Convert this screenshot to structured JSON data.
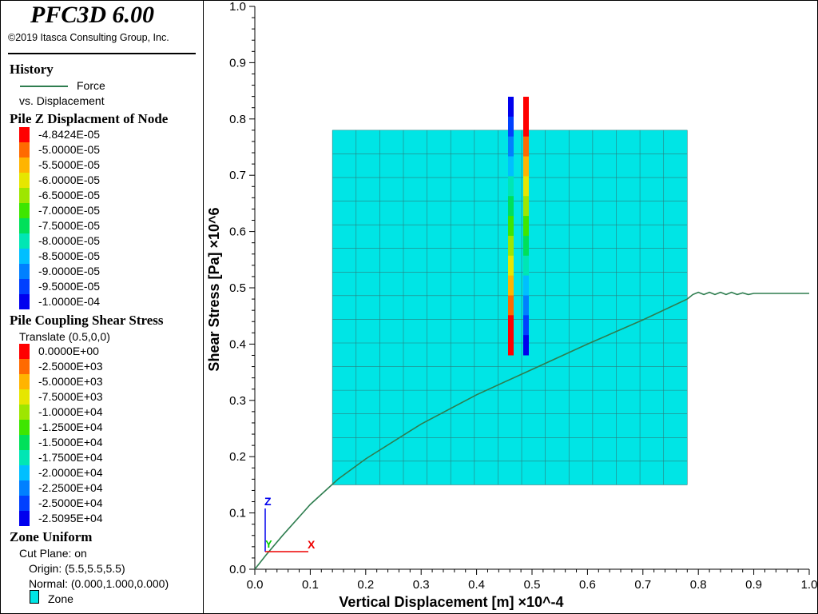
{
  "header": {
    "app_title": "PFC3D 6.00",
    "copyright": "©2019 Itasca Consulting Group, Inc."
  },
  "legend": {
    "history": {
      "heading": "History",
      "series_label": "Force",
      "sub_label": "vs. Displacement",
      "line_color": "#2e7d4f"
    },
    "pile_z": {
      "heading": "Pile Z Displacment of Node",
      "labels": [
        "-4.8424E-05",
        "-5.0000E-05",
        "-5.5000E-05",
        "-6.0000E-05",
        "-6.5000E-05",
        "-7.0000E-05",
        "-7.5000E-05",
        "-8.0000E-05",
        "-8.5000E-05",
        "-9.0000E-05",
        "-9.5000E-05",
        "-1.0000E-04"
      ],
      "colors": [
        "#ff0000",
        "#ff6a00",
        "#ffb400",
        "#e6e600",
        "#9ee600",
        "#3ee600",
        "#00e05a",
        "#00e6b4",
        "#00bfff",
        "#0080ff",
        "#0040ff",
        "#0000ee"
      ]
    },
    "pile_shear": {
      "heading": "Pile Coupling Shear Stress",
      "subtitle": "Translate (0.5,0,0)",
      "labels": [
        "0.0000E+00",
        "-2.5000E+03",
        "-5.0000E+03",
        "-7.5000E+03",
        "-1.0000E+04",
        "-1.2500E+04",
        "-1.5000E+04",
        "-1.7500E+04",
        "-2.0000E+04",
        "-2.2500E+04",
        "-2.5000E+04",
        "-2.5095E+04"
      ],
      "colors": [
        "#ff0000",
        "#ff6a00",
        "#ffb400",
        "#e6e600",
        "#9ee600",
        "#3ee600",
        "#00e05a",
        "#00e6b4",
        "#00bfff",
        "#0080ff",
        "#0040ff",
        "#0000ee"
      ]
    },
    "zone": {
      "heading": "Zone Uniform",
      "cut_plane": "Cut Plane: on",
      "origin": "Origin: (5.5,5.5,5.5)",
      "normal": "Normal: (0.000,1.000,0.000)",
      "swatch_label": "Zone",
      "swatch_color": "#00e5e5"
    }
  },
  "chart_data": {
    "type": "line",
    "xlabel": "Vertical Displacement [m] ×10^-4",
    "ylabel": "Shear Stress [Pa] ×10^6",
    "xlim": [
      0,
      1.0
    ],
    "ylim": [
      0,
      1.0
    ],
    "x_ticks": [
      "0.0",
      "0.1",
      "0.2",
      "0.3",
      "0.4",
      "0.5",
      "0.6",
      "0.7",
      "0.8",
      "0.9",
      "1.0"
    ],
    "y_ticks": [
      "0.0",
      "0.1",
      "0.2",
      "0.3",
      "0.4",
      "0.5",
      "0.6",
      "0.7",
      "0.8",
      "0.9",
      "1.0"
    ],
    "grid": false,
    "series": [
      {
        "color": "#2e7d4f",
        "x": [
          0.0,
          0.02,
          0.05,
          0.1,
          0.15,
          0.2,
          0.3,
          0.4,
          0.5,
          0.6,
          0.7,
          0.78,
          0.79,
          0.8,
          0.81,
          0.82,
          0.83,
          0.84,
          0.85,
          0.86,
          0.87,
          0.88,
          0.89,
          0.9,
          1.0
        ],
        "y": [
          0.0,
          0.025,
          0.06,
          0.115,
          0.16,
          0.196,
          0.258,
          0.31,
          0.355,
          0.4,
          0.443,
          0.48,
          0.488,
          0.492,
          0.488,
          0.492,
          0.488,
          0.492,
          0.488,
          0.492,
          0.488,
          0.491,
          0.488,
          0.49,
          0.49
        ]
      }
    ]
  },
  "overlay": {
    "zone_color": "#00e5e5",
    "grid_color": "#2b7d7d",
    "left_pile_colors": [
      "#0000ee",
      "#0040ff",
      "#0080ff",
      "#00bfff",
      "#00e6b4",
      "#00e05a",
      "#3ee600",
      "#9ee600",
      "#e6e600",
      "#ffb400",
      "#ff6a00",
      "#ff0000",
      "#ff0000"
    ],
    "right_pile_colors": [
      "#ff0000",
      "#ff0000",
      "#ff6a00",
      "#ffb400",
      "#e6e600",
      "#9ee600",
      "#3ee600",
      "#00e05a",
      "#00e6b4",
      "#00bfff",
      "#0080ff",
      "#0040ff",
      "#0000ee"
    ],
    "axes_triad": {
      "z_label": "Z",
      "y_label": "Y",
      "x_label": "X",
      "z_color": "#0000ee",
      "y_color": "#00cc00",
      "x_color": "#ee0000"
    }
  }
}
